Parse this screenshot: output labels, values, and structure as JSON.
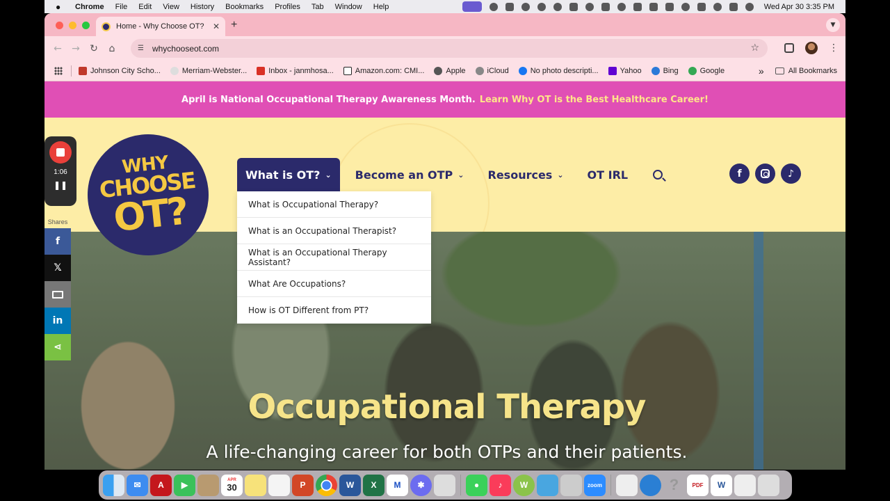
{
  "menubar": {
    "app_name": "Chrome",
    "items": [
      "File",
      "Edit",
      "View",
      "History",
      "Bookmarks",
      "Profiles",
      "Tab",
      "Window",
      "Help"
    ],
    "clock": "Wed Apr 30  3:35 PM"
  },
  "browser": {
    "tab_title": "Home - Why Choose OT?",
    "tab_close": "✕",
    "new_tab": "+",
    "url": "whychooseot.com",
    "bookmarks": [
      {
        "label": "Johnson City Scho...",
        "color": "#c0392b"
      },
      {
        "label": "Merriam-Webster...",
        "color": "#cccccc"
      },
      {
        "label": "Inbox - janmhosa...",
        "color": "#d93025"
      },
      {
        "label": "Amazon.com: CMI...",
        "color": "#222222"
      },
      {
        "label": "Apple",
        "color": "#555555"
      },
      {
        "label": "iCloud",
        "color": "#888888"
      },
      {
        "label": "No photo descripti...",
        "color": "#1877f2"
      },
      {
        "label": "Yahoo",
        "color": "#6001d2"
      },
      {
        "label": "Bing",
        "color": "#2b7ad8"
      },
      {
        "label": "Google",
        "color": "#34a853"
      }
    ],
    "more_bookmarks": "»",
    "all_bookmarks": "All Bookmarks"
  },
  "site": {
    "banner_text": "April is National Occupational Therapy Awareness Month.",
    "banner_link": "Learn Why OT is the Best Healthcare Career!",
    "logo": {
      "line1": "WHY",
      "line2": "CHOOSE",
      "line3": "OT?"
    },
    "nav": [
      {
        "label": "What is OT?",
        "has_menu": true
      },
      {
        "label": "Become an OTP",
        "has_menu": true
      },
      {
        "label": "Resources",
        "has_menu": true
      },
      {
        "label": "OT IRL",
        "has_menu": false
      }
    ],
    "dropdown": [
      "What is Occupational Therapy?",
      "What is an Occupational Therapist?",
      "What is an Occupational Therapy Assistant?",
      "What Are Occupations?",
      "How is OT Different from PT?"
    ],
    "social": {
      "facebook": "f"
    },
    "hero_title": "Occupational Therapy",
    "hero_subtitle": "A life-changing career for both OTPs and their patients.",
    "share": {
      "label": "Shares",
      "facebook": "f",
      "x": "𝕏",
      "linkedin": "in"
    }
  },
  "recorder": {
    "time": "1:06"
  },
  "dock": {
    "calendar_month": "APR",
    "calendar_day": "30"
  },
  "colors": {
    "brand_navy": "#2b2a6b",
    "brand_yellow": "#f5c842",
    "banner_pink": "#e04fb5",
    "header_cream": "#fdeda6"
  }
}
